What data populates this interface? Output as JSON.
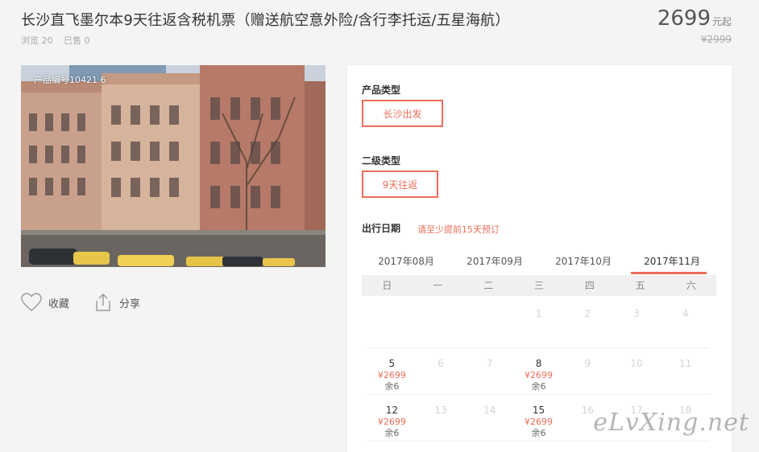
{
  "product": {
    "title": "长沙直飞墨尔本9天往返含税机票（赠送航空意外险/含行李托运/五星海航）",
    "views": "浏览 20",
    "sold": "已售 0",
    "price": "2699",
    "price_unit": "元起",
    "original_price": "¥2999",
    "code": "产品编号10421 6"
  },
  "actions": {
    "favorite": "收藏",
    "share": "分享"
  },
  "options": {
    "type_label": "产品类型",
    "type_value": "长沙出发",
    "sub_label": "二级类型",
    "sub_value": "9天往返",
    "date_label": "出行日期",
    "date_hint": "请至少提前15天预订"
  },
  "calendar": {
    "months": [
      "2017年08月",
      "2017年09月",
      "2017年10月",
      "2017年11月"
    ],
    "active_month": 3,
    "weekdays": [
      "日",
      "一",
      "二",
      "三",
      "四",
      "五",
      "六"
    ],
    "rows": [
      [
        {
          "d": ""
        },
        {
          "d": ""
        },
        {
          "d": ""
        },
        {
          "d": "1",
          "off": true
        },
        {
          "d": "2",
          "off": true
        },
        {
          "d": "3",
          "off": true
        },
        {
          "d": "4",
          "off": true
        }
      ],
      [
        {
          "d": "5",
          "p": "¥2699",
          "s": "余6"
        },
        {
          "d": "6",
          "off": true
        },
        {
          "d": "7",
          "off": true
        },
        {
          "d": "8",
          "p": "¥2699",
          "s": "余6"
        },
        {
          "d": "9",
          "off": true
        },
        {
          "d": "10",
          "off": true
        },
        {
          "d": "11",
          "off": true
        }
      ],
      [
        {
          "d": "12",
          "p": "¥2699",
          "s": "余6"
        },
        {
          "d": "13",
          "off": true
        },
        {
          "d": "14",
          "off": true
        },
        {
          "d": "15",
          "p": "¥2699",
          "s": "余6"
        },
        {
          "d": "16",
          "off": true
        },
        {
          "d": "17",
          "off": true
        },
        {
          "d": "18",
          "off": true
        }
      ]
    ]
  },
  "watermark": "eLvXing.net",
  "colors": {
    "accent": "#ec6d59",
    "background": "#f4f4f4"
  }
}
